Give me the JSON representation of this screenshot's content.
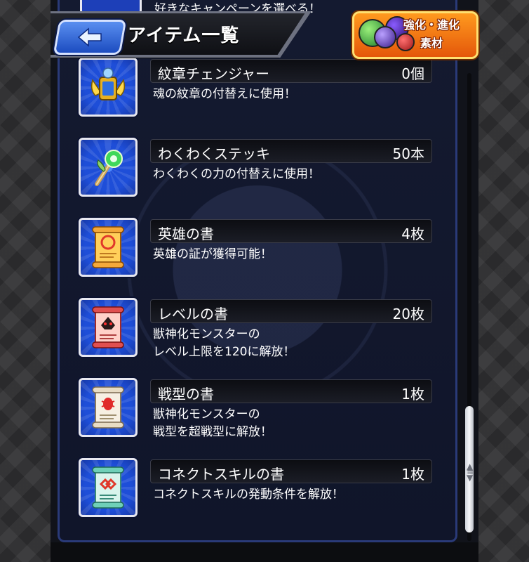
{
  "top_peek": {
    "text": "好きなキャンペーンを選べる！"
  },
  "header": {
    "back_label": "back",
    "title": "アイテム一覧"
  },
  "badge": {
    "line1": "強化・進化",
    "line2": "素材"
  },
  "items": [
    {
      "name": "紋章チェンジャー",
      "count": "0個",
      "desc": "魂の紋章の付替えに使用！",
      "icon": "emblem-changer-icon"
    },
    {
      "name": "わくわくステッキ",
      "count": "50本",
      "desc": "わくわくの力の付替えに使用！",
      "icon": "wakuwaku-stick-icon"
    },
    {
      "name": "英雄の書",
      "count": "4枚",
      "desc": "英雄の証が獲得可能！",
      "icon": "hero-scroll-icon"
    },
    {
      "name": "レベルの書",
      "count": "20枚",
      "desc": "獣神化モンスターの\nレベル上限を120に解放！",
      "icon": "level-scroll-icon"
    },
    {
      "name": "戦型の書",
      "count": "1枚",
      "desc": "獣神化モンスターの\n戦型を超戦型に解放！",
      "icon": "battle-type-scroll-icon"
    },
    {
      "name": "コネクトスキルの書",
      "count": "1枚",
      "desc": "コネクトスキルの発動条件を解放！",
      "icon": "connect-skill-scroll-icon"
    }
  ],
  "colors": {
    "accent_blue": "#1e4ed8",
    "badge_orange": "#ff9a1f",
    "panel_border": "#2a3a78"
  }
}
